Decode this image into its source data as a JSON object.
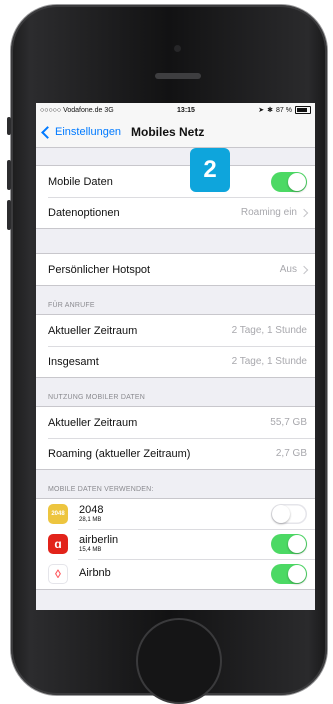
{
  "status": {
    "carrier": "○○○○○ Vodafone.de  3G",
    "time": "13:15",
    "battery": "87 %"
  },
  "nav": {
    "back_label": "Einstellungen",
    "title": "Mobiles Netz"
  },
  "groups": {
    "mobile_data": {
      "label": "Mobile Daten",
      "enabled": true
    },
    "data_options": {
      "label": "Datenoptionen",
      "value": "Roaming ein"
    },
    "hotspot": {
      "label": "Persönlicher Hotspot",
      "value": "Aus"
    }
  },
  "calls": {
    "header": "FÜR ANRUFE",
    "rows": [
      {
        "label": "Aktueller Zeitraum",
        "value": "2 Tage, 1 Stunde"
      },
      {
        "label": "Insgesamt",
        "value": "2 Tage, 1 Stunde"
      }
    ]
  },
  "usage": {
    "header": "NUTZUNG MOBILER DATEN",
    "rows": [
      {
        "label": "Aktueller Zeitraum",
        "value": "55,7 GB"
      },
      {
        "label": "Roaming (aktueller Zeitraum)",
        "value": "2,7 GB"
      }
    ]
  },
  "apps": {
    "header": "MOBILE DATEN VERWENDEN:",
    "items": [
      {
        "name": "2048",
        "size": "28,1 MB",
        "icon_text": "2048",
        "color": "#edc53f",
        "enabled": false
      },
      {
        "name": "airberlin",
        "size": "15,4 MB",
        "icon_text": "ɑ",
        "color": "#e2231a",
        "enabled": true
      },
      {
        "name": "Airbnb",
        "size": "",
        "icon_text": "◊",
        "color": "#ffffff",
        "enabled": true
      }
    ]
  },
  "overlay": {
    "badge": "2",
    "badge_color": "#0ea5dc"
  }
}
